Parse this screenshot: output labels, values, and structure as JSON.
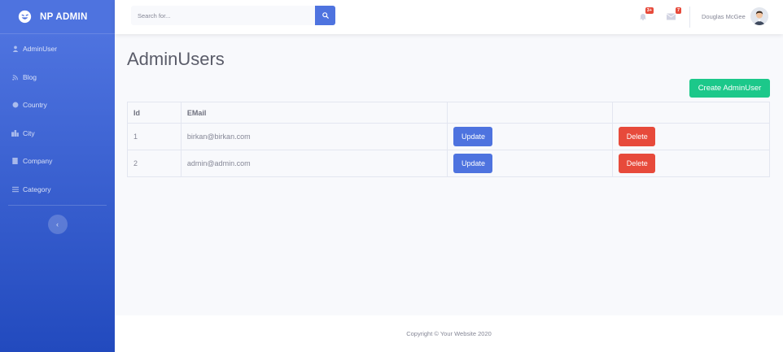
{
  "brand": {
    "name": "NP ADMIN"
  },
  "sidebar": {
    "items": [
      {
        "label": "AdminUser",
        "icon": "user-icon"
      },
      {
        "label": "Blog",
        "icon": "blog-icon"
      },
      {
        "label": "Country",
        "icon": "globe-icon"
      },
      {
        "label": "City",
        "icon": "city-icon"
      },
      {
        "label": "Company",
        "icon": "company-icon"
      },
      {
        "label": "Category",
        "icon": "list-icon"
      }
    ],
    "toggle_icon": "chevron-left-icon"
  },
  "topbar": {
    "search_placeholder": "Search for...",
    "alerts_badge": "3+",
    "messages_badge": "7",
    "user_name": "Douglas McGee"
  },
  "page": {
    "title": "AdminUsers",
    "create_label": "Create AdminUser"
  },
  "table": {
    "headers": [
      "Id",
      "EMail",
      "",
      ""
    ],
    "rows": [
      {
        "id": "1",
        "email": "birkan@birkan.com",
        "update": "Update",
        "delete": "Delete"
      },
      {
        "id": "2",
        "email": "admin@admin.com",
        "update": "Update",
        "delete": "Delete"
      }
    ]
  },
  "footer": {
    "text": "Copyright © Your Website 2020"
  },
  "colors": {
    "primary": "#4e73df",
    "success": "#1cc88a",
    "danger": "#e74a3b",
    "background": "#f8f9fc"
  }
}
